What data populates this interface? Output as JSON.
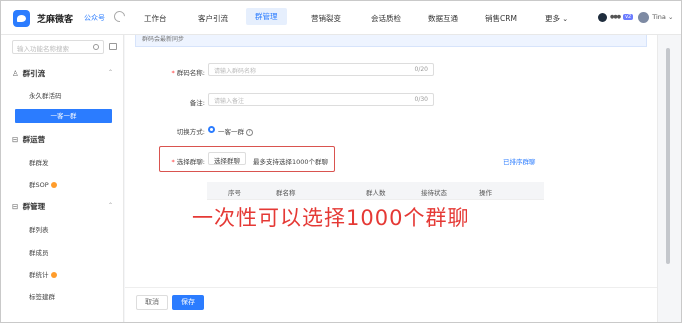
{
  "brand": {
    "name": "芝麻微客",
    "sub": "公众号"
  },
  "nav": {
    "items": [
      "工作台",
      "客户引流",
      "群管理",
      "营销裂变",
      "会话质检",
      "数据互通",
      "销售CRM",
      "更多"
    ],
    "active_index": 2
  },
  "user": {
    "dots": "●●●",
    "vip": "v2",
    "name": "Tina"
  },
  "sidebar": {
    "search_placeholder": "输入功能名称搜索",
    "groups": [
      {
        "title": "群引流",
        "items": [
          "永久群活码",
          "一客一群"
        ]
      },
      {
        "title": "群运营",
        "items": [
          "群群发",
          "群SOP"
        ]
      },
      {
        "title": "群管理",
        "items": [
          "群列表",
          "群成员",
          "群统计",
          "标签建群"
        ]
      }
    ],
    "active_item": "一客一群"
  },
  "form": {
    "notice": "群码会最新同步",
    "name_label": "群码名称:",
    "name_placeholder": "请输入群码名称",
    "name_counter": "0/20",
    "remark_label": "备注:",
    "remark_placeholder": "请输入备注",
    "remark_counter": "0/30",
    "mode_label": "切换方式:",
    "mode_option": "一客一群",
    "help_glyph": "?",
    "group_label": "选择群聊:",
    "select_button": "选择群聊",
    "select_hint": "最多支持选择1000个群聊",
    "sort_link": "已排序群聊"
  },
  "table": {
    "columns": [
      "序号",
      "群名称",
      "群人数",
      "接待状态",
      "操作"
    ]
  },
  "caption": "一次性可以选择1000个群聊",
  "footer": {
    "cancel": "取消",
    "save": "保存"
  }
}
